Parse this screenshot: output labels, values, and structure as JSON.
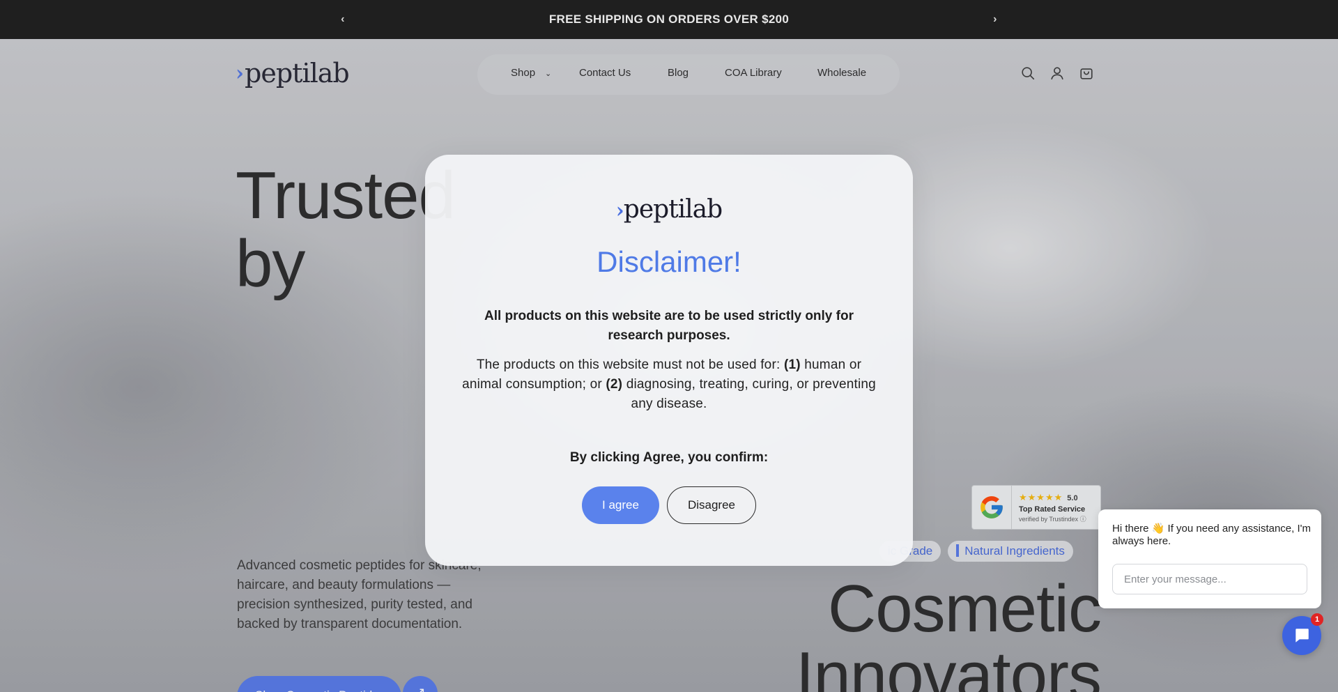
{
  "announcement": {
    "text": "FREE SHIPPING ON ORDERS OVER $200",
    "prev_icon": "chevron-left-icon",
    "next_icon": "chevron-right-icon"
  },
  "header": {
    "logo_text": "peptilab",
    "nav": [
      {
        "label": "Shop",
        "has_dropdown": true
      },
      {
        "label": "Contact Us"
      },
      {
        "label": "Blog"
      },
      {
        "label": "COA Library"
      },
      {
        "label": "Wholesale"
      }
    ],
    "icons": [
      "search-icon",
      "account-icon",
      "cart-icon"
    ]
  },
  "hero": {
    "title_left": [
      "Trusted",
      "by"
    ],
    "description": "Advanced cosmetic peptides for skincare, haircare, and beauty formulations — precision synthesized, purity tested, and backed by transparent documentation.",
    "cta_label": "Shop Cosmetic Peptides",
    "title_right": [
      "Cosmetic",
      "Innovators"
    ],
    "pills": [
      "ic Grade",
      "Natural Ingredients"
    ]
  },
  "trust_badge": {
    "stars": "★★★★★",
    "score": "5.0",
    "title": "Top Rated Service",
    "subtitle": "verified by Trustindex"
  },
  "modal": {
    "logo_text": "peptilab",
    "title": "Disclaimer!",
    "bold_text": "All products on this website are to be used strictly only for research purposes.",
    "body_intro": "The products on this website must not be used for:",
    "item1_num": "(1)",
    "item1_text": "human or animal consumption; or",
    "item2_num": "(2)",
    "item2_text": "diagnosing, treating, curing, or preventing any disease.",
    "confirm_text": "By clicking Agree, you confirm:",
    "agree_label": "I agree",
    "disagree_label": "Disagree"
  },
  "chat": {
    "greeting": "Hi there 👋 If you need any assistance, I'm always here.",
    "input_placeholder": "Enter your message...",
    "badge_count": "1"
  },
  "colors": {
    "accent": "#4f74e6",
    "announcement_bg": "#1f1f1f",
    "modal_title": "#4f7ae6"
  }
}
